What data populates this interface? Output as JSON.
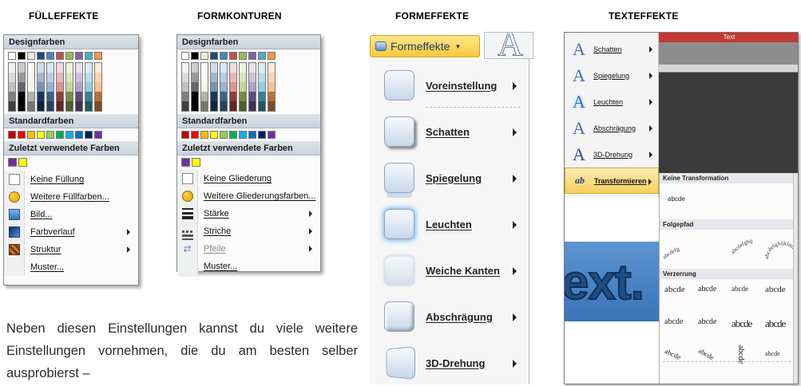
{
  "headings": {
    "fuelleffekte": "FÜLLEFFEKTE",
    "formkonturen": "FORMKONTUREN",
    "formeffekte": "FORMEFFEKTE",
    "texteffekte": "TEXTEFFEKTE"
  },
  "fill_menu": {
    "design_colors_label": "Designfarben",
    "standard_colors_label": "Standardfarben",
    "recent_colors_label": "Zuletzt verwendete Farben",
    "items": [
      {
        "label": "Keine Füllung",
        "icon": "blank-square-icon",
        "submenu": false
      },
      {
        "label": "Weitere Füllfarben...",
        "icon": "palette-icon",
        "submenu": false
      },
      {
        "label": "Bild...",
        "icon": "picture-icon",
        "submenu": false
      },
      {
        "label": "Farbverlauf",
        "icon": "gradient-icon",
        "submenu": true
      },
      {
        "label": "Struktur",
        "icon": "texture-icon",
        "submenu": true
      },
      {
        "label": "Muster...",
        "icon": "",
        "submenu": false
      }
    ]
  },
  "outline_menu": {
    "design_colors_label": "Designfarben",
    "standard_colors_label": "Standardfarben",
    "recent_colors_label": "Zuletzt verwendete Farben",
    "items": [
      {
        "label": "Keine Gliederung",
        "icon": "blank-square-icon",
        "submenu": false
      },
      {
        "label": "Weitere Gliederungsfarben...",
        "icon": "palette-icon",
        "submenu": false
      },
      {
        "label": "Stärke",
        "icon": "line-weight-icon",
        "submenu": true
      },
      {
        "label": "Striche",
        "icon": "dashes-icon",
        "submenu": true
      },
      {
        "label": "Pfeile",
        "icon": "arrows-icon",
        "submenu": true,
        "disabled": true
      },
      {
        "label": "Muster...",
        "icon": "",
        "submenu": false
      }
    ]
  },
  "theme_colors": [
    "#ffffff",
    "#000000",
    "#eeece1",
    "#1f497d",
    "#4f81bd",
    "#c0504d",
    "#9bbb59",
    "#8064a2",
    "#4bacc6",
    "#f79646"
  ],
  "standard_colors": [
    "#c00000",
    "#ff0000",
    "#ffc000",
    "#ffff00",
    "#92d050",
    "#00b050",
    "#00b0f0",
    "#0070c0",
    "#002060",
    "#7030a0"
  ],
  "recent_colors": [
    "#7030a0",
    "#ffff00"
  ],
  "shape_effects": {
    "button_label": "Formeffekte",
    "items": [
      {
        "label": "Voreinstellung",
        "accel": "V"
      },
      {
        "label": "Schatten",
        "accel": "n"
      },
      {
        "label": "Spiegelung",
        "accel": "S"
      },
      {
        "label": "Leuchten",
        "accel": "L"
      },
      {
        "label": "Weiche Kanten",
        "accel": "W"
      },
      {
        "label": "Abschrägung",
        "accel": "b"
      },
      {
        "label": "3D-Drehung",
        "accel": "D"
      }
    ]
  },
  "text_effects": {
    "ruler_label": "Text",
    "items": [
      {
        "label": "Schatten"
      },
      {
        "label": "Spiegelung"
      },
      {
        "label": "Leuchten"
      },
      {
        "label": "Abschrägung"
      },
      {
        "label": "3D-Drehung"
      },
      {
        "label": "Transformieren"
      }
    ],
    "transform": {
      "no_transform_label": "Keine Transformation",
      "sample": "abcde",
      "path_label": "Folgepfad",
      "path_samples": [
        "abcdefg",
        "abcdefghij",
        "abcdefghijklmno"
      ],
      "warp_label": "Verzerrung",
      "big_text": "ext."
    }
  },
  "paragraph": "Neben diesen Einstellungen kannst du viele weitere Einstellungen vornehmen, die du am besten selber ausprobierst –"
}
